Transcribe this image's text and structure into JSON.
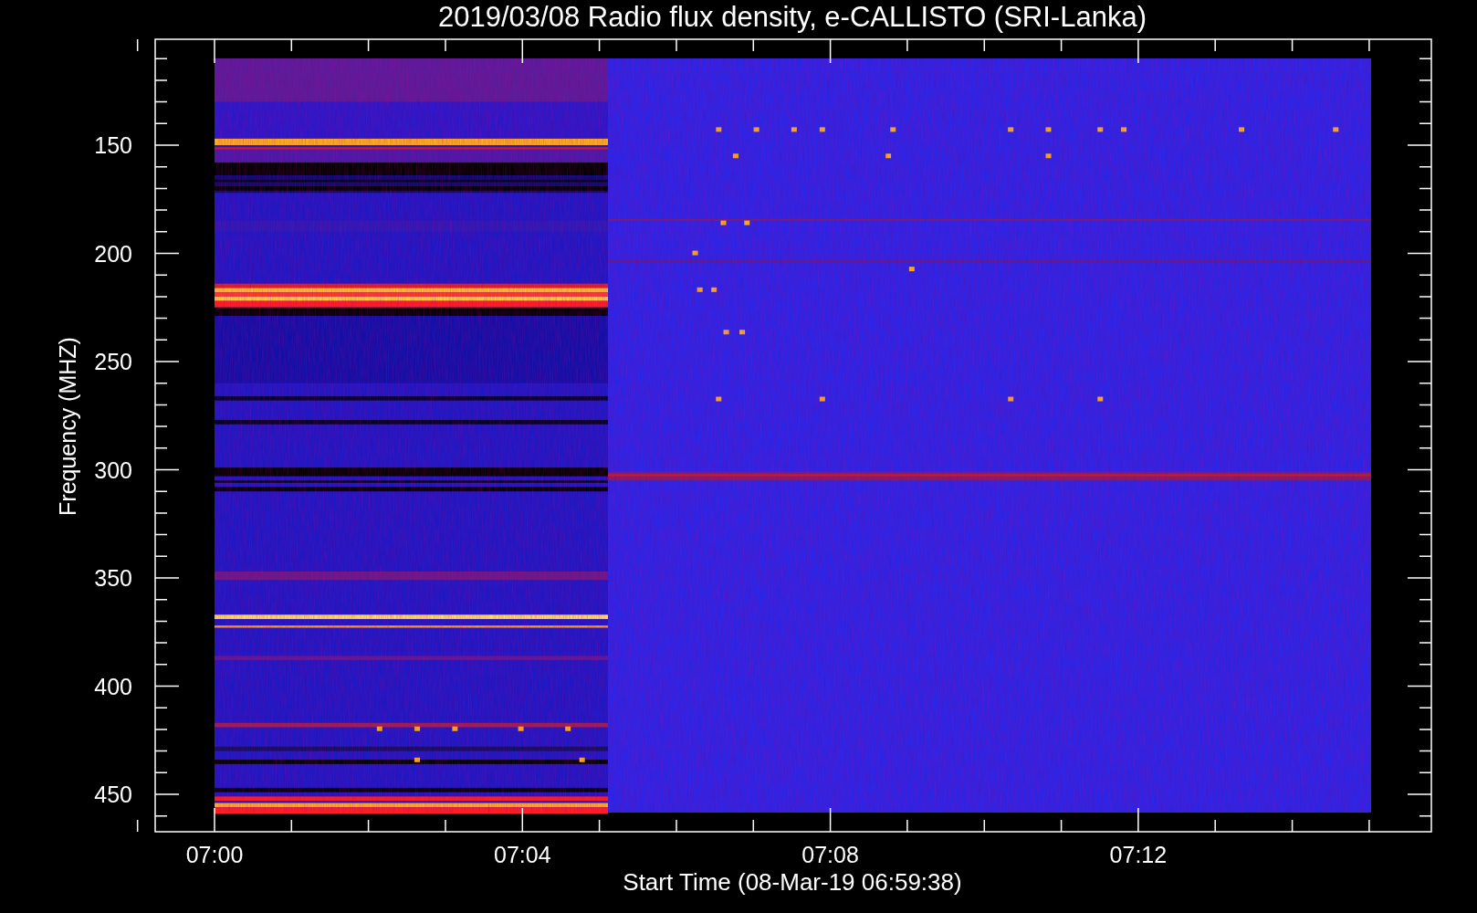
{
  "title": "2019/03/08  Radio flux density, e-CALLISTO (SRI-Lanka)",
  "y_axis": {
    "label": "Frequency (MHZ)",
    "ticks": [
      "150",
      "200",
      "250",
      "300",
      "350",
      "400",
      "450"
    ]
  },
  "x_axis": {
    "label": "Start Time (08-Mar-19 06:59:38)",
    "ticks": [
      "07:00",
      "07:04",
      "07:08",
      "07:12"
    ]
  }
}
